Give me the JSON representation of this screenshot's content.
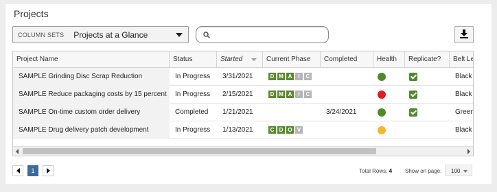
{
  "page": {
    "title": "Projects"
  },
  "toolbar": {
    "column_sets_label": "COLUMN SETS",
    "column_set_value": "Projects at a Glance",
    "search_value": "",
    "download_icon": "download-icon"
  },
  "grid": {
    "columns": [
      "Project Name",
      "Status",
      "Started",
      "Current Phase",
      "Completed",
      "Health",
      "Replicate?",
      "Belt Level"
    ],
    "sorted_column": "Started",
    "rows": [
      {
        "name": "SAMPLE Grinding Disc Scrap Reduction",
        "status": "In Progress",
        "started": "3/31/2021",
        "phases": [
          {
            "l": "D",
            "done": true
          },
          {
            "l": "M",
            "done": true
          },
          {
            "l": "A",
            "done": true
          },
          {
            "l": "I",
            "done": false
          },
          {
            "l": "C",
            "done": false
          }
        ],
        "completed": "",
        "health_color": "#4f8a2a",
        "replicate": true,
        "belt": "Black Belt"
      },
      {
        "name": "SAMPLE Reduce packaging costs by 15 percent",
        "status": "In Progress",
        "started": "2/15/2021",
        "phases": [
          {
            "l": "D",
            "done": true
          },
          {
            "l": "M",
            "done": true
          },
          {
            "l": "A",
            "done": true
          },
          {
            "l": "I",
            "done": false
          },
          {
            "l": "C",
            "done": false
          }
        ],
        "completed": "",
        "health_color": "#e51a1a",
        "replicate": true,
        "belt": "Black Belt"
      },
      {
        "name": "SAMPLE On-time custom order delivery",
        "status": "Completed",
        "started": "1/21/2021",
        "phases": [],
        "completed": "3/24/2021",
        "health_color": "#4f8a2a",
        "replicate": true,
        "belt": "Green Belt"
      },
      {
        "name": "SAMPLE Drug delivery patch development",
        "status": "In Progress",
        "started": "1/13/2021",
        "phases": [
          {
            "l": "C",
            "done": true
          },
          {
            "l": "D",
            "done": true
          },
          {
            "l": "O",
            "done": true
          },
          {
            "l": "V",
            "done": false
          }
        ],
        "completed": "",
        "health_color": "#f2b82f",
        "replicate": false,
        "belt": "Black Belt"
      }
    ]
  },
  "footer": {
    "current_page": "1",
    "total_rows_label": "Total Rows:",
    "total_rows": "4",
    "show_on_page_label": "Show on page:",
    "show_on_page_value": "100"
  }
}
